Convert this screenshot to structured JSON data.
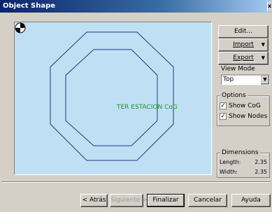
{
  "window": {
    "title": "Object Shape",
    "close_glyph": "x"
  },
  "canvas": {
    "background": "#bfe0f4",
    "object_label": "TER ESTACION CoG"
  },
  "side": {
    "edit_label": "Edit...",
    "import_label": "Import",
    "export_label": "Export",
    "view_mode": {
      "title": "View Mode",
      "value": "Top"
    },
    "options": {
      "title": "Options",
      "show_cog": {
        "label": "Show CoG",
        "checked": true
      },
      "show_nodes": {
        "label": "Show Nodes",
        "checked": true
      }
    },
    "dimensions": {
      "title": "Dimensions",
      "length_label": "Length:",
      "length_value": "2.35",
      "width_label": "Width:",
      "width_value": "2.35"
    }
  },
  "footer": {
    "back_label": "< Atrás",
    "next_label": "Siguiente >",
    "finish_label": "Finalizar",
    "cancel_label": "Cancelar",
    "help_label": "Ayuda"
  }
}
